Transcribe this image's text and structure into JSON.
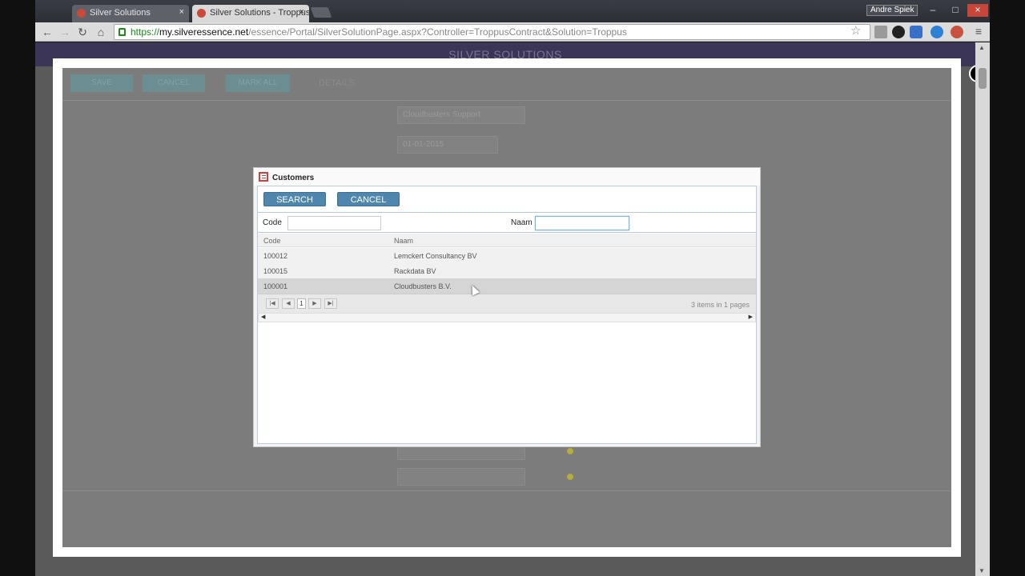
{
  "browser": {
    "tabs": [
      {
        "label": "Silver Solutions",
        "active": false
      },
      {
        "label": "Silver Solutions - Troppus",
        "active": true
      }
    ],
    "user": "Andre Spiek",
    "url_scheme": "https://",
    "url_host": "my.silveressence.net",
    "url_path": "/essence/Portal/SilverSolutionPage.aspx?Controller=TroppusContract&Solution=Troppus"
  },
  "page": {
    "header_title": "SILVER SOLUTIONS"
  },
  "outer_modal": {
    "buttons": [
      "SAVE",
      "CANCEL",
      "MARK ALL"
    ],
    "tab_label": "DETAILS",
    "field_value_1": "Cloudbusters Support",
    "field_value_2": "01-01-2015"
  },
  "dialog": {
    "title": "Customers",
    "search_label": "SEARCH",
    "cancel_label": "CANCEL",
    "filter_code_label": "Code",
    "filter_naam_label": "Naam",
    "filter_code_value": "",
    "filter_naam_value": "",
    "columns": [
      "Code",
      "Naam"
    ],
    "rows": [
      {
        "code": "100012",
        "naam": "Lemckert Consultancy BV"
      },
      {
        "code": "100015",
        "naam": "Rackdata BV"
      },
      {
        "code": "100001",
        "naam": "Cloudbusters B.V."
      }
    ],
    "selected_row": 2,
    "pager": {
      "current_page": "1",
      "info": "3 items in 1 pages"
    }
  },
  "colors": {
    "button": "#4f86ad",
    "header": "#3b3558",
    "overlay": "#7c7c7c"
  }
}
